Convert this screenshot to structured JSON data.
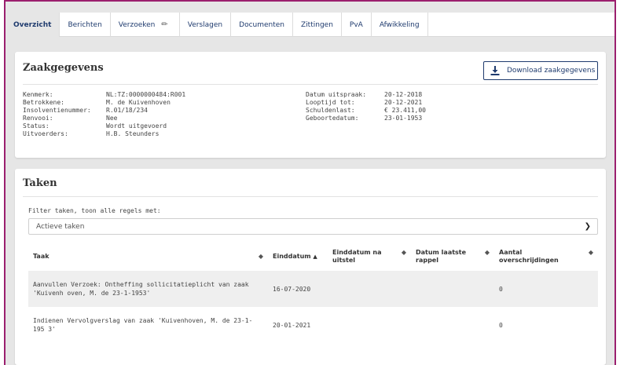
{
  "tabs": [
    {
      "label": "Overzicht"
    },
    {
      "label": "Berichten"
    },
    {
      "label": "Verzoeken"
    },
    {
      "label": "Verslagen"
    },
    {
      "label": "Documenten"
    },
    {
      "label": "Zittingen"
    },
    {
      "label": "PvA"
    },
    {
      "label": "Afwikkeling"
    }
  ],
  "zaak": {
    "title": "Zaakgegevens",
    "download_label": "Download zaakgegevens",
    "left": [
      {
        "label": "Kenmerk:",
        "value": "NL:TZ:0000000484:R001"
      },
      {
        "label": "Betrokkene:",
        "value": "M. de Kuivenhoven"
      },
      {
        "label": "Insolventienummer:",
        "value": "R.01/18/234"
      },
      {
        "label": "Renvooi:",
        "value": "Nee"
      },
      {
        "label": "Status:",
        "value": "Wordt uitgevoerd"
      },
      {
        "label": "Uitvoerders:",
        "value": "H.B. Steunders"
      }
    ],
    "right": [
      {
        "label": "Datum uitspraak:",
        "value": "20-12-2018"
      },
      {
        "label": "Looptijd tot:",
        "value": "20-12-2021"
      },
      {
        "label": "Schuldenlast:",
        "value": "€ 23.411,00"
      },
      {
        "label": "Geboortedatum:",
        "value": "23-01-1953"
      }
    ]
  },
  "taken": {
    "title": "Taken",
    "filter_label": "Filter taken, toon alle regels met:",
    "filter_value": "Actieve taken",
    "columns": {
      "taak": "Taak",
      "einddatum": "Einddatum",
      "einddatum_na_uitstel": "Einddatum na uitstel",
      "datum_laatste_rappel": "Datum laatste rappel",
      "aantal_overschrijdingen": "Aantal overschrijdingen"
    },
    "rows": [
      {
        "taak": "Aanvullen Verzoek: Ontheffing sollicitatieplicht van zaak 'Kuivenh oven, M. de 23-1-1953'",
        "einddatum": "16-07-2020",
        "uitstel": "",
        "rappel": "",
        "aantal": "0"
      },
      {
        "taak": "Indienen Vervolgverslag van zaak 'Kuivenhoven, M. de 23-1-195 3'",
        "einddatum": "20-01-2021",
        "uitstel": "",
        "rappel": "",
        "aantal": "0"
      }
    ]
  }
}
